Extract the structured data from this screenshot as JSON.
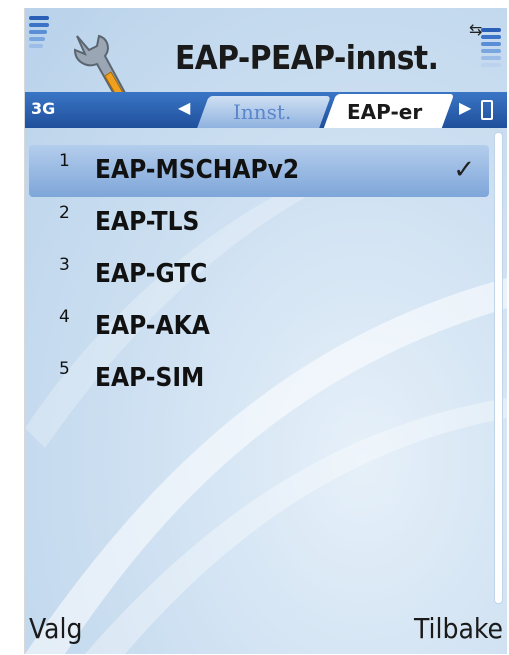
{
  "header": {
    "title": "EAP-PEAP-innst.",
    "network": "3G",
    "icons": [
      "signal-strength-icon",
      "wrench-settings-icon",
      "connection-icon",
      "battery-icon"
    ]
  },
  "tabs": [
    {
      "label": "Innst.",
      "active": false
    },
    {
      "label": "EAP-er",
      "active": true
    }
  ],
  "list": {
    "items": [
      {
        "number": "1",
        "label": "EAP-MSCHAPv2",
        "checked": true,
        "selected": true
      },
      {
        "number": "2",
        "label": "EAP-TLS",
        "checked": false,
        "selected": false
      },
      {
        "number": "3",
        "label": "EAP-GTC",
        "checked": false,
        "selected": false
      },
      {
        "number": "4",
        "label": "EAP-AKA",
        "checked": false,
        "selected": false
      },
      {
        "number": "5",
        "label": "EAP-SIM",
        "checked": false,
        "selected": false
      }
    ],
    "check_glyph": "✓"
  },
  "softkeys": {
    "left": "Valg",
    "right": "Tilbake"
  },
  "colors": {
    "tab_bar": "#1f4f9b",
    "selection": "#7ea6d9",
    "background": "#cfe1f2"
  }
}
